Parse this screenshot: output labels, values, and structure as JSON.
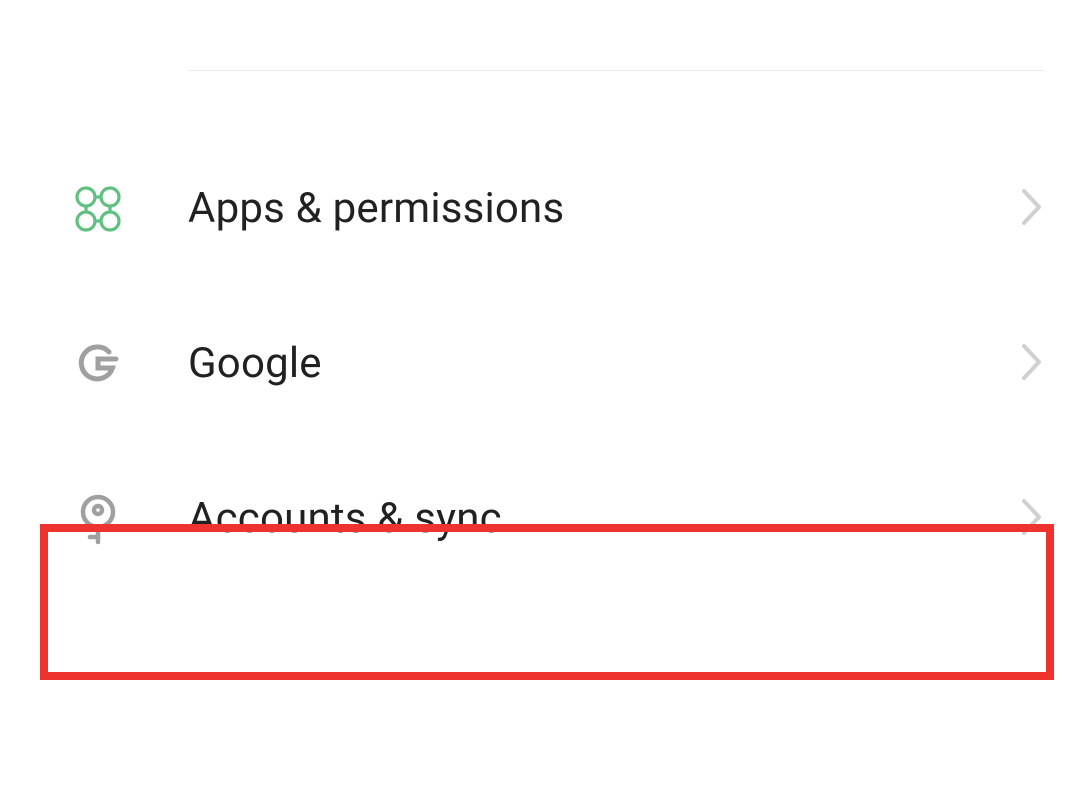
{
  "settings": {
    "items": [
      {
        "label": "Apps & permissions",
        "icon": "apps-icon",
        "highlighted": false
      },
      {
        "label": "Google",
        "icon": "google-icon",
        "highlighted": false
      },
      {
        "label": "Accounts & sync",
        "icon": "key-icon",
        "highlighted": true
      }
    ]
  },
  "colors": {
    "apps_icon": "#5fc080",
    "gray_icon": "#a0a0a0",
    "chevron": "#d0d0d0",
    "highlight_border": "#ee322e",
    "text": "#212121"
  }
}
